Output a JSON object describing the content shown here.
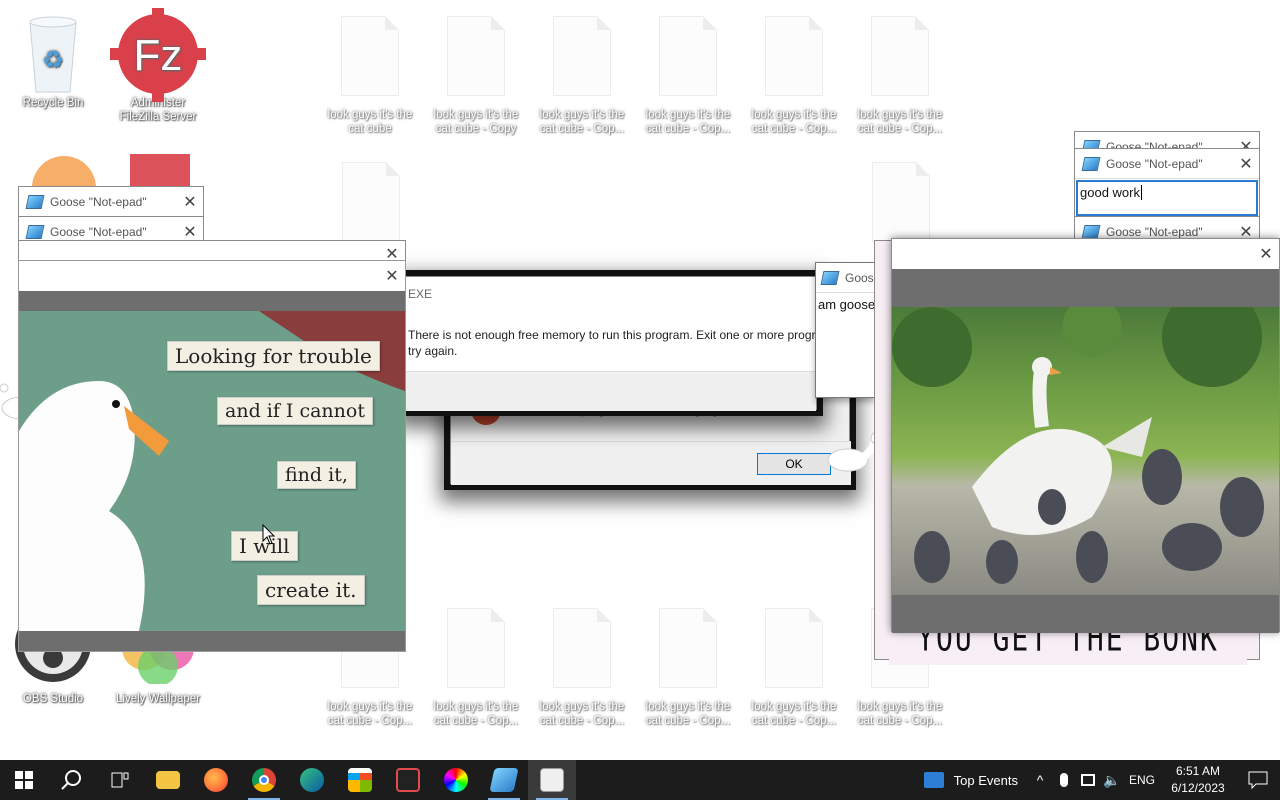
{
  "desktop": {
    "icons": [
      {
        "label": "Recycle Bin"
      },
      {
        "label": "Administer FileZilla Server"
      },
      {
        "label": "OBS Studio"
      },
      {
        "label": "Lively Wallpaper"
      }
    ],
    "cat_cube_top": [
      "look guys it's the cat cube",
      "look guys it's the cat cube - Copy",
      "look guys it's the cat cube - Cop...",
      "look guys it's the cat cube - Cop...",
      "look guys it's the cat cube - Cop...",
      "look guys it's the cat cube - Cop..."
    ],
    "cat_cube_bottom": [
      "look guys it's the cat cube - Cop...",
      "look guys it's the cat cube - Cop...",
      "look guys it's the cat cube - Cop...",
      "look guys it's the cat cube - Cop...",
      "look guys it's the cat cube - Cop...",
      "look guys it's the cat cube - Cop..."
    ]
  },
  "notepads": {
    "title": "Goose \"Not-epad\"",
    "right_text": "good work",
    "mid_text": "am goose",
    "mid_title": "Goos"
  },
  "meme": {
    "lines": [
      "Looking for trouble",
      "and if I cannot",
      "find it,",
      "I will",
      "create it."
    ]
  },
  "error": {
    "title": "EXE",
    "message": "There is not enough free memory to run this program. Exit one or more progr",
    "message2": "try again.",
    "behind_text": "one or more programs, and then try again.",
    "ok": "OK"
  },
  "goose_photo": {
    "caption": "YOU GET THE BONK"
  },
  "taskbar": {
    "apps": [
      "start-icon",
      "search-icon",
      "task-view-icon",
      "file-explorer-icon",
      "firefox-icon",
      "chrome-icon",
      "edge-icon",
      "store-icon",
      "snipping-icon",
      "color-icon",
      "notepad-icon",
      "goose-icon"
    ],
    "widget": "Top Events",
    "lang": "ENG",
    "time": "6:51 AM",
    "date": "6/12/2023"
  }
}
